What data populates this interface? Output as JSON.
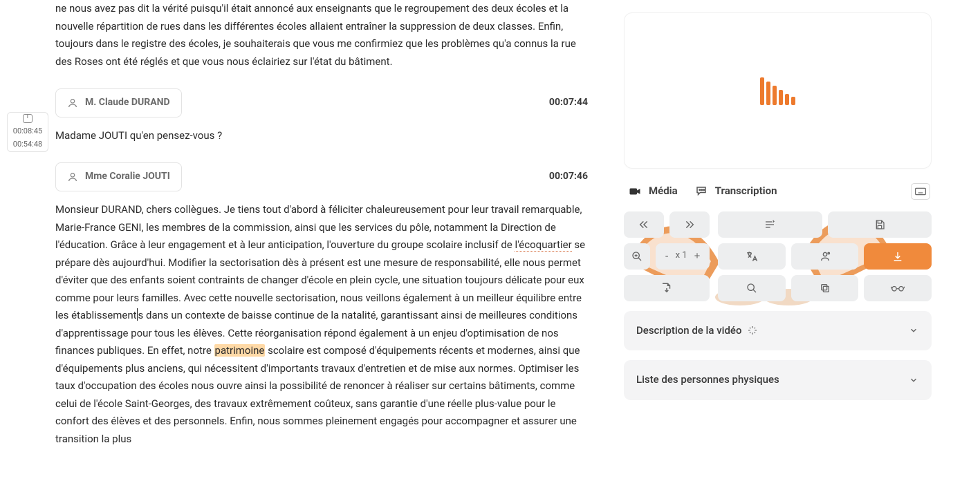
{
  "timeBox": {
    "t1": "00:08:45",
    "t2": "00:54:48"
  },
  "transcript": {
    "para0": "ne nous avez pas dit la vérité puisqu'il était annoncé aux enseignants que le regroupement des deux écoles et la nouvelle répartition de rues dans les différentes écoles allaient entraîner la suppression de deux classes. Enfin, toujours dans le registre des écoles, je souhaiterais que vous me confirmiez que les problèmes qu'a connus la rue des Roses ont été réglés et que vous nous éclairiez sur l'état du bâtiment.",
    "speaker1": {
      "name": "M. Claude DURAND",
      "ts": "00:07:44",
      "text": "Madame JOUTI qu'en pensez-vous ?"
    },
    "speaker2": {
      "name": "Mme Coralie JOUTI",
      "ts": "00:07:46",
      "textA": "Monsieur DURAND, chers collègues. Je tiens tout d'abord à féliciter chaleureusement pour leur travail remarquable, Marie-France GENI, les membres de la commission, ainsi que les services du pôle, notamment la Direction de l'éducation. Grâce à leur engagement et à leur anticipation, l'ouverture du groupe scolaire inclusif de ",
      "dotted1": "l'écoquartier",
      "textB": " se prépare dès aujourd'hui. Modifier la sectorisation dès à présent est une mesure de responsabilité, elle nous permet d'éviter que des enfants soient contraints de changer d'école en plein cycle, une situation toujours délicate pour eux comme pour leurs familles. Avec cette nouvelle sectorisation, nous veillons également à un meilleur équilibre entre les établissement",
      "textC": "s dans un contexte de baisse continue de la natalité, garantissant ainsi de meilleures conditions d'apprentissage pour tous les élèves. Cette réorganisation répond également à un enjeu d'optimisation de nos finances publiques. En effet, notre ",
      "highlight": "patrimoine",
      "textD": " scolaire est composé d'équipements récents et modernes, ainsi que d'équipements plus anciens, qui nécessitent d'importants travaux d'entretien et de mise aux normes. Optimiser les taux d'occupation des écoles nous ouvre ainsi la possibilité de renoncer à réaliser sur certains bâtiments, comme celui de l'école Saint-Georges, des travaux extrêmement coûteux, sans garantie d'une réelle plus-value pour le confort des élèves et des personnels. Enfin, nous sommes pleinement engagés pour accompagner et assurer une transition la plus"
    }
  },
  "rightPanel": {
    "tabs": {
      "media": "Média",
      "transcription": "Transcription"
    },
    "zoom": {
      "label": "x 1"
    },
    "accordions": {
      "desc": "Description de la vidéo",
      "people": "Liste des personnes physiques"
    }
  },
  "colors": {
    "accent": "#ed7a2d"
  }
}
